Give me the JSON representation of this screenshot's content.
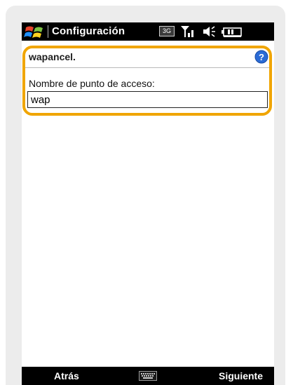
{
  "window": {
    "title": "Configuración",
    "network_badge": "3G",
    "status_icons": [
      "windows-start-icon",
      "signal-strength-icon",
      "volume-icon",
      "battery-icon"
    ]
  },
  "form": {
    "header": "wapancel.",
    "help_icon": "help-icon",
    "field_label": "Nombre de punto de acceso:",
    "field_value": "wap"
  },
  "softkeys": {
    "left": "Atrás",
    "center_icon": "keyboard-icon",
    "right": "Siguiente"
  },
  "colors": {
    "highlight": "#f0a500",
    "bar_background": "#000000",
    "help_icon": "#2a6bd6"
  }
}
